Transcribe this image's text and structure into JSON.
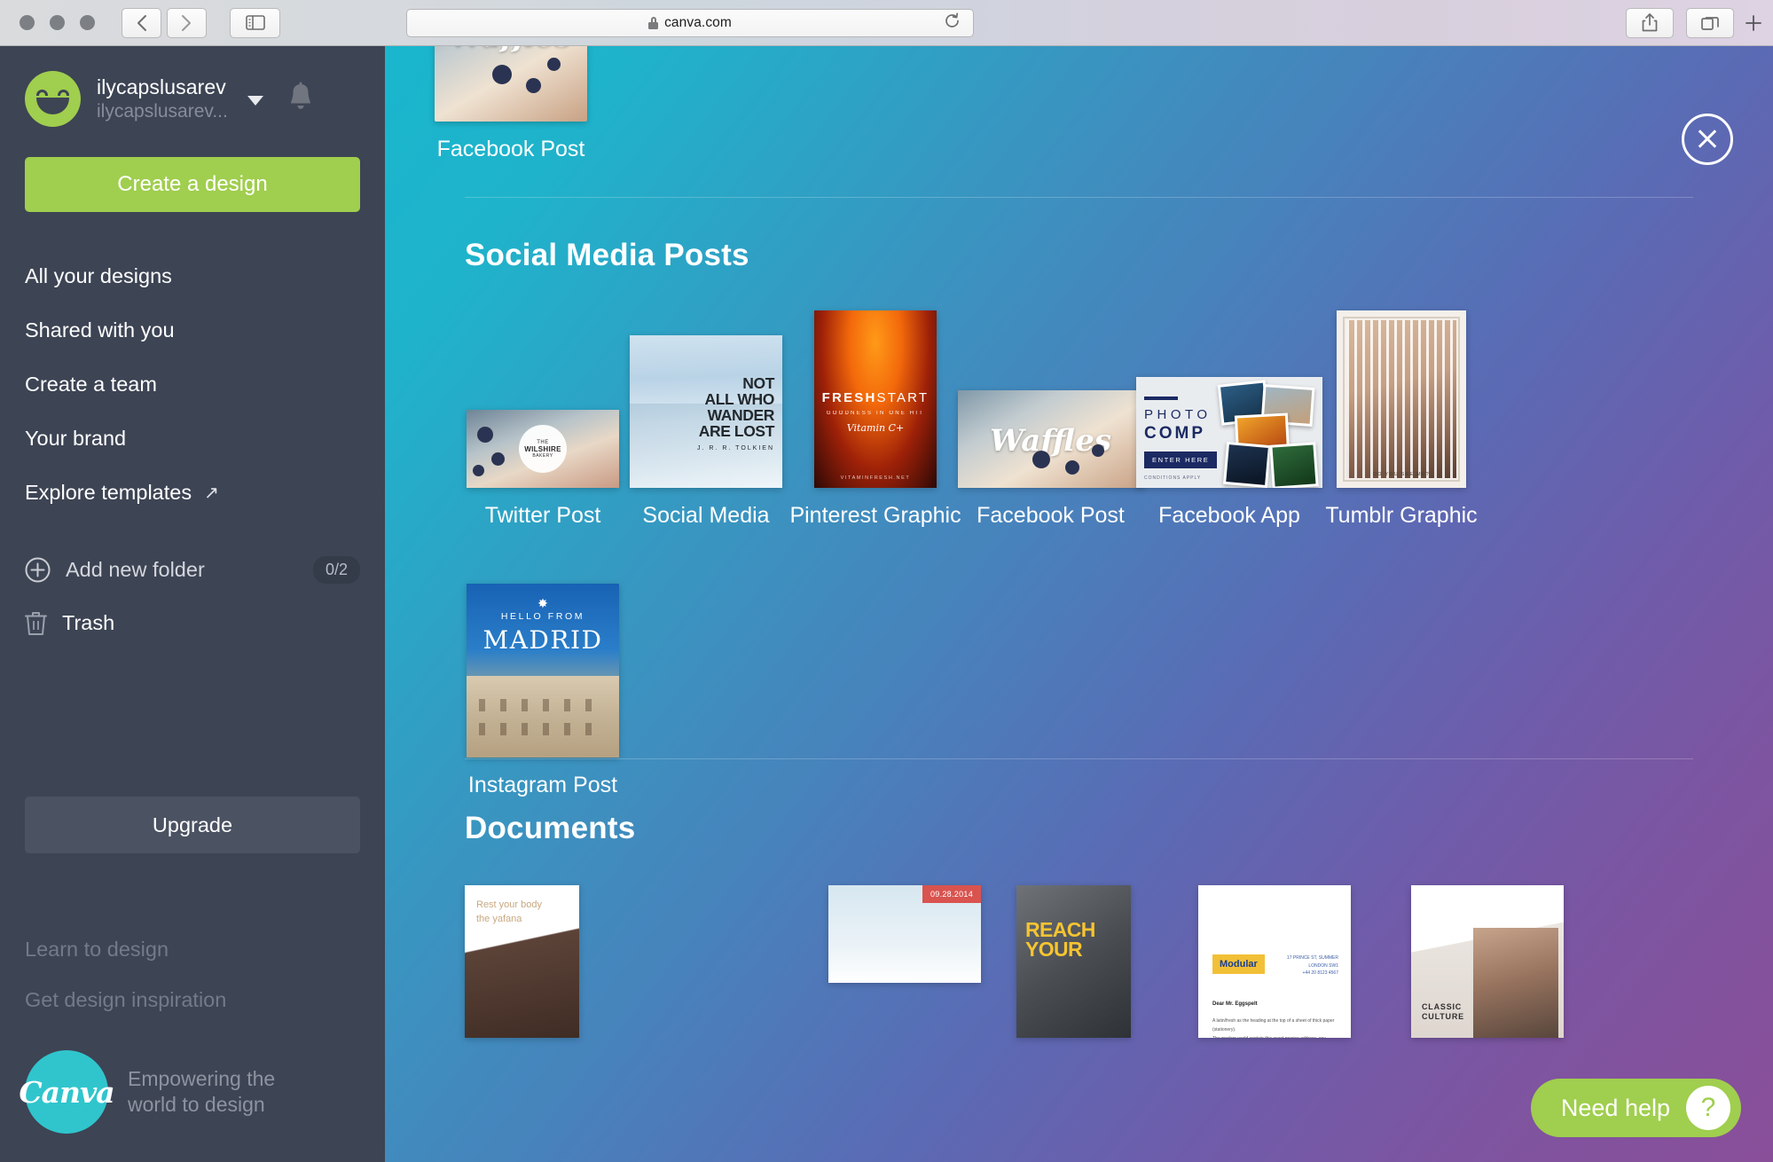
{
  "browser": {
    "url": "canva.com",
    "lock_icon": "lock-icon",
    "back_icon": "chevron-left-icon",
    "forward_icon": "chevron-right-icon",
    "sidebar_icon": "sidebar-panel-icon",
    "reload_icon": "reload-icon",
    "share_icon": "share-icon",
    "tabs_icon": "show-tabs-icon",
    "new_tab_icon": "plus-icon"
  },
  "sidebar": {
    "user": {
      "name": "ilycapslusarev",
      "email": "ilycapslusarev...",
      "avatar_icon": "smiley-avatar",
      "dropdown_icon": "chevron-down-icon",
      "notifications_icon": "bell-icon"
    },
    "create_button": "Create a design",
    "nav_items": [
      {
        "label": "All your designs"
      },
      {
        "label": "Shared with you"
      },
      {
        "label": "Create a team"
      },
      {
        "label": "Your brand"
      },
      {
        "label": "Explore templates",
        "external_icon": "↗"
      }
    ],
    "add_folder": {
      "label": "Add new folder",
      "count": "0/2",
      "icon": "plus-circle-icon"
    },
    "trash": {
      "label": "Trash",
      "icon": "trash-icon"
    },
    "upgrade_button": "Upgrade",
    "bottom_links": [
      {
        "label": "Learn to design"
      },
      {
        "label": "Get design inspiration"
      }
    ],
    "footer": {
      "logo_text": "Canva",
      "tagline": "Empowering the world to design"
    }
  },
  "main": {
    "close_icon": "close-circle-icon",
    "top_item": {
      "label": "Facebook Post",
      "art_text": "Waffles"
    },
    "sections": [
      {
        "title": "Social Media Posts",
        "items": [
          {
            "label": "Twitter Post",
            "art": "twitter-waffle",
            "badge_line1": "THE",
            "badge_line2": "WILSHIRE",
            "badge_line3": "BAKERY"
          },
          {
            "label": "Social Media",
            "art": "mountain-quote",
            "quote_lines": [
              "NOT",
              "ALL WHO",
              "WANDER",
              "ARE LOST"
            ],
            "attribution": "J. R. R. TOLKIEN"
          },
          {
            "label": "Pinterest Graphic",
            "art": "fresh-start",
            "title_bold": "FRESH",
            "title_light": "START",
            "subtitle": "GOODNESS IN ONE HIT",
            "script": "Vitamin C+",
            "footer": "VITAMINFRESH.NET"
          },
          {
            "label": "Facebook Post",
            "art": "waffles",
            "art_text": "Waffles"
          },
          {
            "label": "Facebook App",
            "art": "photo-comp",
            "line1": "PHOTO",
            "line2": "COMP",
            "cta": "ENTER HERE",
            "fine_print": "CONDITIONS APPLY"
          },
          {
            "label": "Tumblr Graphic",
            "art": "tumblr-face",
            "caption": "DO YOU SEE ME?"
          }
        ],
        "items_row2": [
          {
            "label": "Instagram Post",
            "art": "madrid",
            "star": "✸",
            "line1": "HELLO FROM",
            "line2": "MADRID"
          }
        ]
      },
      {
        "title": "Documents",
        "items": [
          {
            "art": "spa-doc",
            "text": "Rest your body\nthe yafana\nspa way."
          },
          {
            "art": "snow-doc",
            "date": "09.28.2014"
          },
          {
            "art": "reach-doc",
            "line1": "REACH",
            "line2": "YOUR"
          },
          {
            "art": "modular-letter",
            "logo": "Modular",
            "address": "17 PRINCE ST, SUMMER\nLONDON SW1\n+44 20 8123 4567",
            "salutation": "Dear Mr. Eggspelt",
            "body": "A latin/fresh as the heading at the top of a sheet of thick paper (stationery).\nThe modern world contain this exact precise address, any contact."
          },
          {
            "art": "classic-culture",
            "line1": "CLASSIC",
            "line2": "CULTURE"
          }
        ]
      }
    ],
    "need_help": {
      "label": "Need help",
      "icon": "question-mark-icon"
    }
  }
}
